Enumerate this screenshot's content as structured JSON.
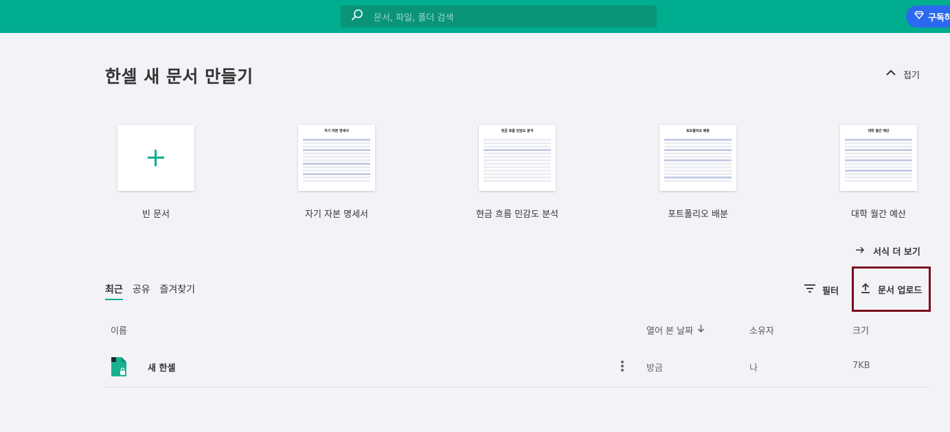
{
  "topbar": {
    "search_placeholder": "문서, 파일, 폴더 검색",
    "subscribe_label": "구독하기"
  },
  "create": {
    "title": "한셀 새 문서 만들기",
    "collapse_label": "접기",
    "templates": [
      {
        "label": "빈 문서",
        "thumb_title": ""
      },
      {
        "label": "자기 자본 명세서",
        "thumb_title": "자기 자본 명세서"
      },
      {
        "label": "현금 흐름 민감도 분석",
        "thumb_title": "현금 흐름 민감도 분석"
      },
      {
        "label": "포트폴리오 배분",
        "thumb_title": "포트폴리오 배분"
      },
      {
        "label": "대학 월간 예산",
        "thumb_title": "대학 월간 예산"
      }
    ],
    "more_label": "서식 더 보기"
  },
  "files": {
    "tabs": [
      "최근",
      "공유",
      "즐겨찾기"
    ],
    "active_tab": "최근",
    "filter_label": "필터",
    "upload_label": "문서 업로드",
    "columns": {
      "name": "이름",
      "opened": "열어 본 날짜",
      "owner": "소유자",
      "size": "크기"
    },
    "rows": [
      {
        "name": "새 한셀",
        "opened": "방금",
        "owner": "나",
        "size": "7KB"
      }
    ]
  },
  "colors": {
    "brand": "#00ad8e",
    "subscribe": "#2b6af0",
    "upload_highlight": "#7a0c1e"
  },
  "icons": {
    "search": "search-icon",
    "subscribe": "diamond-icon",
    "collapse": "chevron-up-icon",
    "more": "arrow-right-icon",
    "filter": "filter-icon",
    "upload": "upload-icon",
    "sort": "arrow-down-icon",
    "file": "spreadsheet-file-icon",
    "menu": "more-vertical-icon"
  }
}
